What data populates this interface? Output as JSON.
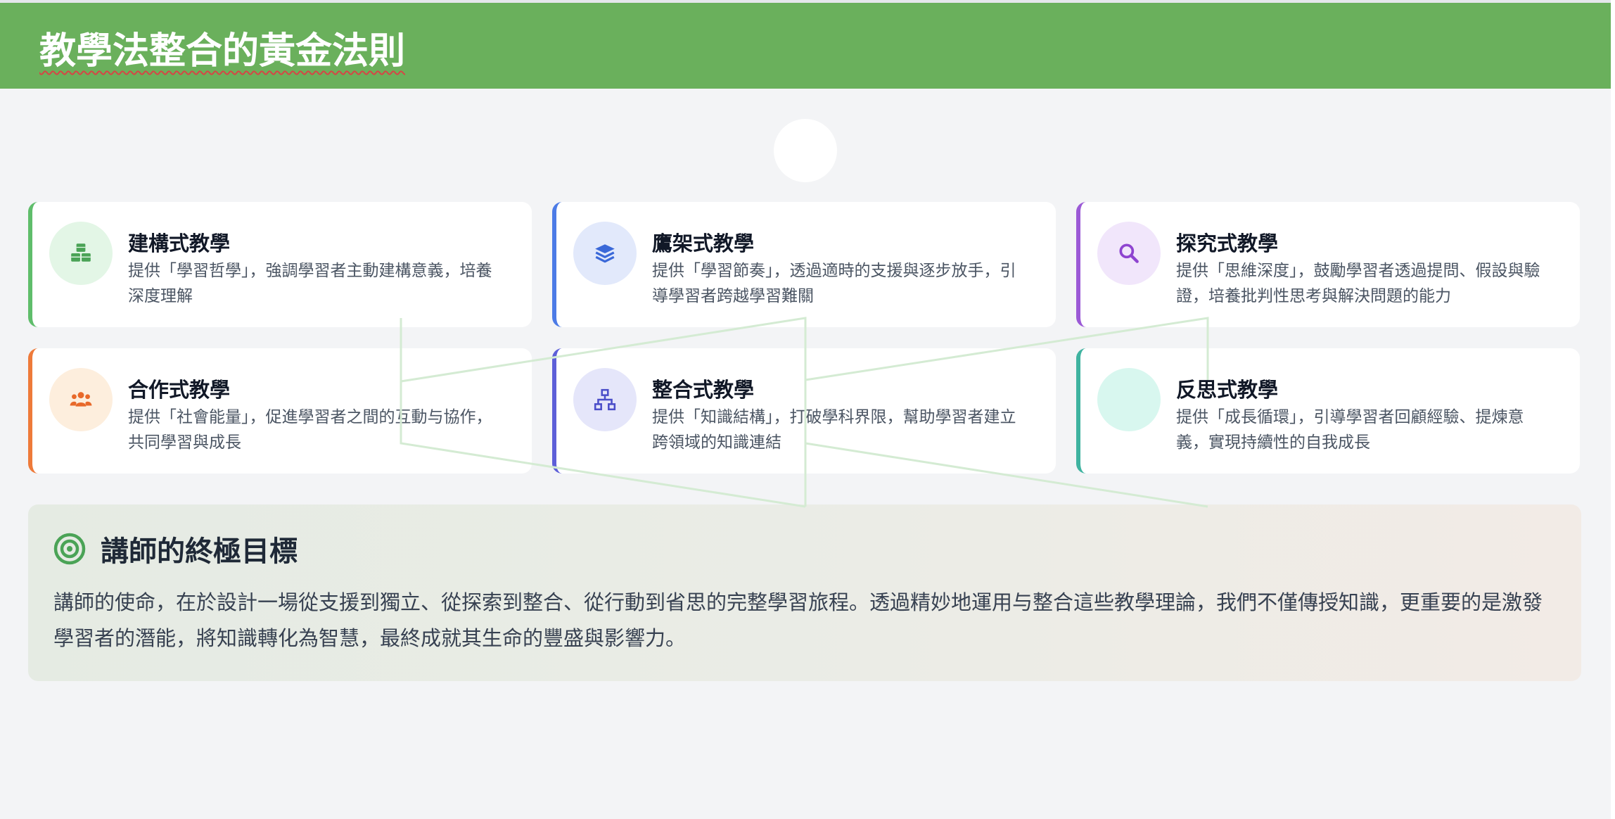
{
  "header": {
    "title": "教學法整合的黃金法則"
  },
  "colors": {
    "header_bg": "#6ab05c",
    "page_bg": "#f3f4f6",
    "constructive": "#5fbd6b",
    "scaffolding": "#4c7be6",
    "inquiry": "#9b59d6",
    "cooperative": "#ee7a3a",
    "integrative": "#5d5fd8",
    "reflective": "#3fb3a0",
    "connector_line": "#d4ebd3"
  },
  "cards": [
    {
      "title": "建構式教學",
      "desc": "提供「學習哲學」，強調學習者主動建構意義，培養深度理解",
      "icon": "cubes-icon"
    },
    {
      "title": "鷹架式教學",
      "desc": "提供「學習節奏」，透過適時的支援與逐步放手，引導學習者跨越學習難關",
      "icon": "layers-icon"
    },
    {
      "title": "探究式教學",
      "desc": "提供「思維深度」，鼓勵學習者透過提問、假設與驗證，培養批判性思考與解決問題的能力",
      "icon": "search-icon"
    },
    {
      "title": "合作式教學",
      "desc": "提供「社會能量」，促進學習者之間的互動与協作，共同學習與成長",
      "icon": "people-icon"
    },
    {
      "title": "整合式教學",
      "desc": "提供「知識結構」，打破學科界限，幫助學習者建立跨領域的知識連結",
      "icon": "sitemap-icon"
    },
    {
      "title": "反思式教學",
      "desc": "提供「成長循環」，引導學習者回顧經驗、提煉意義，實現持續性的自我成長",
      "icon": "cycle-icon"
    }
  ],
  "goal": {
    "title": "講師的終極目標",
    "icon": "target-icon",
    "text": "講師的使命，在於設計一場從支援到獨立、從探索到整合、從行動到省思的完整學習旅程。透過精妙地運用与整合這些教學理論，我們不僅傳授知識，更重要的是激發學習者的潛能，將知識轉化為智慧，最終成就其生命的豐盛與影響力。"
  }
}
